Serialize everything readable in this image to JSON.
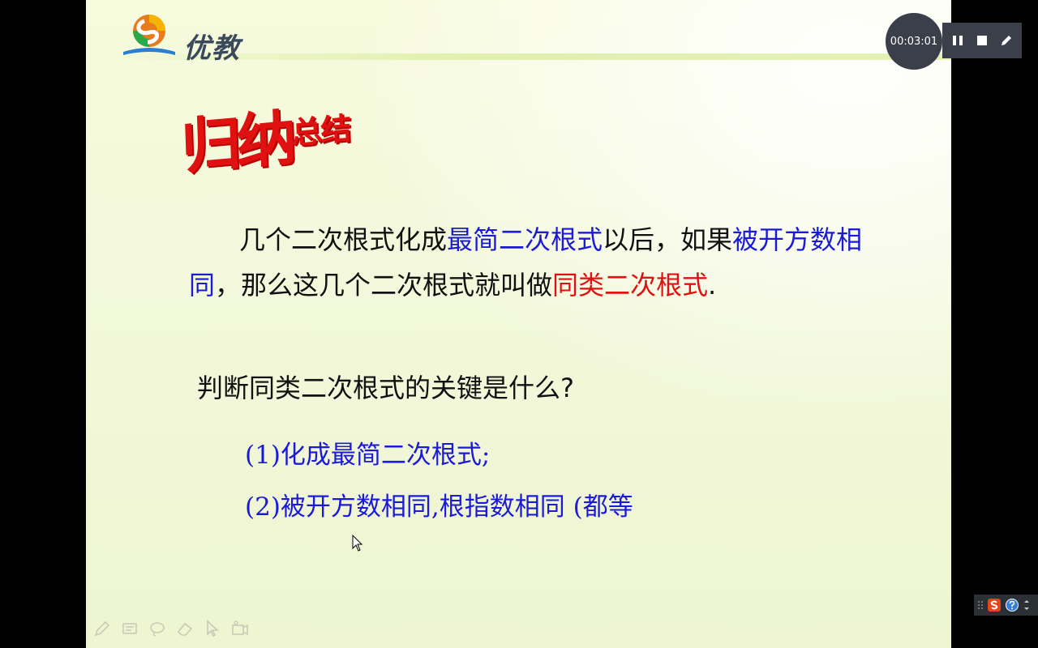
{
  "logo": {
    "text": "优教"
  },
  "slide": {
    "title_big": "归纳",
    "title_small": "总结",
    "paragraph": [
      {
        "t": "几个二次根式化成",
        "c": "black"
      },
      {
        "t": "最简二次根式",
        "c": "blue"
      },
      {
        "t": "以后，如果",
        "c": "black"
      },
      {
        "t": "被开方数相同",
        "c": "blue"
      },
      {
        "t": "，那么这几个二次根式就叫做",
        "c": "black"
      },
      {
        "t": "同类二次根式",
        "c": "red"
      },
      {
        "t": ".",
        "c": "black"
      }
    ],
    "question": "判断同类二次根式的关键是什么?",
    "answer1": "(1)化成最简二次根式;",
    "answer2": "(2)被开方数相同,根指数相同 (都等"
  },
  "recorder": {
    "timer": "00:03:01",
    "icons": [
      "pause-icon",
      "stop-icon",
      "pen-icon"
    ]
  },
  "ime": {
    "icons": [
      "grip-icon",
      "sogou-icon",
      "help-icon",
      "menu-arrow-icon"
    ]
  },
  "bottom_toolbar": {
    "icons": [
      "pen-icon",
      "highlighter-icon",
      "lasso-icon",
      "eraser-icon",
      "pointer-icon",
      "camera-icon"
    ]
  },
  "colors": {
    "blue": "#1a1ad8",
    "red": "#e11111",
    "recorder_bg": "#3b3f4a"
  }
}
